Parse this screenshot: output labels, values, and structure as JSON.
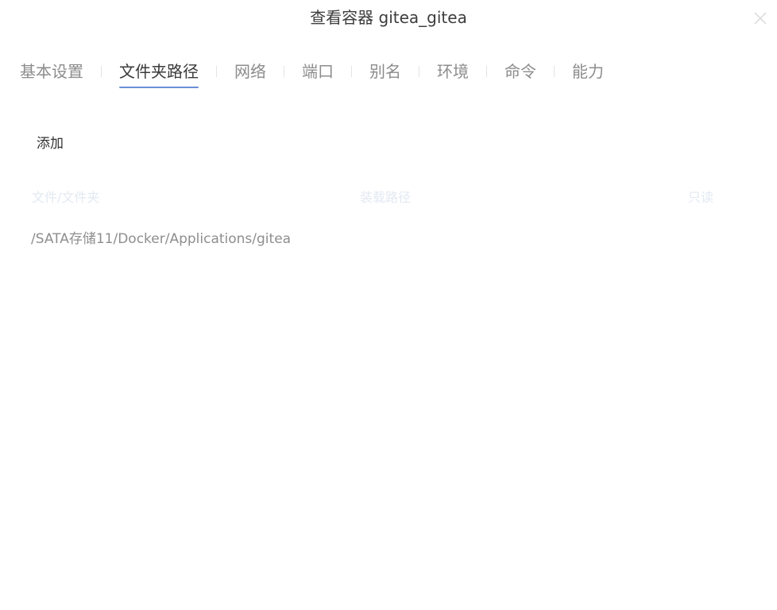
{
  "dialog": {
    "title": "查看容器 gitea_gitea"
  },
  "tabs": [
    {
      "label": "基本设置",
      "active": false
    },
    {
      "label": "文件夹路径",
      "active": true
    },
    {
      "label": "网络",
      "active": false
    },
    {
      "label": "端口",
      "active": false
    },
    {
      "label": "别名",
      "active": false
    },
    {
      "label": "环境",
      "active": false
    },
    {
      "label": "命令",
      "active": false
    },
    {
      "label": "能力",
      "active": false
    }
  ],
  "toolbar": {
    "add_label": "添加"
  },
  "table": {
    "columns": [
      "文件/文件夹",
      "装载路径",
      "只读"
    ],
    "rows": [
      {
        "file": "/SATA存储11/Docker/Applications/gitea",
        "mount": "",
        "readonly": ""
      }
    ]
  },
  "icons": {
    "close": "close-icon"
  },
  "colors": {
    "accent": "#6b8fd6",
    "active_tab_text": "#3a3a3a",
    "inactive_tab_text": "#8c8c8c",
    "header_text": "#e3e9f2",
    "row_text": "#8e8e8e"
  }
}
